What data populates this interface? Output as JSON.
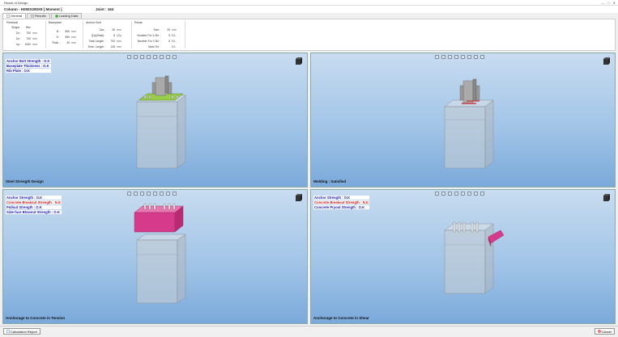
{
  "window": {
    "title": "Result of Design",
    "controls": [
      "—",
      "□",
      "✕"
    ]
  },
  "header": {
    "column": "Column - H250X250X9 [ Moment ]",
    "joint": "Joint : 164"
  },
  "tabs": [
    {
      "label": "General",
      "icon": "general-icon"
    },
    {
      "label": "Results",
      "icon": "results-icon"
    },
    {
      "label": "Loading Data",
      "icon": "loading-data-icon"
    }
  ],
  "info": {
    "pedestal": {
      "title": "Pedestal",
      "rows": [
        {
          "label": "Shape :",
          "value": "Rec",
          "unit": ""
        },
        {
          "label": "Dx :",
          "value": "700",
          "unit": "mm"
        },
        {
          "label": "Dz :",
          "value": "700",
          "unit": "mm"
        },
        {
          "label": "hp :",
          "value": "1000",
          "unit": "mm"
        }
      ]
    },
    "baseplate": {
      "title": "Baseplate",
      "rows": [
        {
          "label": "B :",
          "value": "550",
          "unit": "mm"
        },
        {
          "label": "D :",
          "value": "550",
          "unit": "mm"
        },
        {
          "label": "Thick :",
          "value": "30",
          "unit": "mm"
        }
      ]
    },
    "anchor_bolt": {
      "title": "Anchor Bolt",
      "rows": [
        {
          "label": "Dia :",
          "value": "30",
          "unit": "mm"
        },
        {
          "label": "Q'ty(Total) :",
          "value": "8",
          "unit": "Q'ty"
        },
        {
          "label": "Total Length :",
          "value": "700",
          "unit": "mm"
        },
        {
          "label": "Emb. Length :",
          "value": "128",
          "unit": "mm"
        }
      ]
    },
    "rebar": {
      "title": "Rebar",
      "rows": [
        {
          "label": "Size :",
          "value": "29",
          "unit": "mm"
        },
        {
          "label": "Number For X-Dir :",
          "value": "5",
          "unit": "EA"
        },
        {
          "label": "Number For Y-Dir :",
          "value": "5",
          "unit": "EA"
        },
        {
          "label": "Main Tie :",
          "value": "",
          "unit": "EA"
        }
      ]
    }
  },
  "viewports": [
    {
      "name": "steel-strength",
      "caption": "Steel Strength Design",
      "statuses": [
        {
          "text": "Anchor Bolt Strength : O.K",
          "state": "ok"
        },
        {
          "text": "Baseplate Thickness : O.K",
          "state": "ok"
        },
        {
          "text": "Rib Plate : O.K",
          "state": "ok"
        }
      ]
    },
    {
      "name": "welding",
      "caption": "Welding : Satisfied",
      "statuses": []
    },
    {
      "name": "tension",
      "caption": "Anchorage to Concrete in Tension",
      "statuses": [
        {
          "text": "Anchor Strength : O.K",
          "state": "ok"
        },
        {
          "text": "Concrete Breakout Strength : N.G",
          "state": "ng"
        },
        {
          "text": "Pullout Strength : O.K",
          "state": "ok"
        },
        {
          "text": "Side-face Blowout Strength : O.K",
          "state": "ok"
        }
      ]
    },
    {
      "name": "shear",
      "caption": "Anchorage to Concrete in Shear",
      "statuses": [
        {
          "text": "Anchor Strength : O.K",
          "state": "ok"
        },
        {
          "text": "Concrete Breakout Strength : N.G",
          "state": "ng"
        },
        {
          "text": "Concrete Pryout Strength : O.K",
          "state": "ok"
        }
      ]
    }
  ],
  "footer": {
    "report_button": "Calculation Report",
    "cancel_button": "Cancel"
  },
  "colors": {
    "ok": "#1a1aa8",
    "ng": "#c81414",
    "failure_body": "#d63a8a",
    "plate_green": "#9acd4a"
  }
}
